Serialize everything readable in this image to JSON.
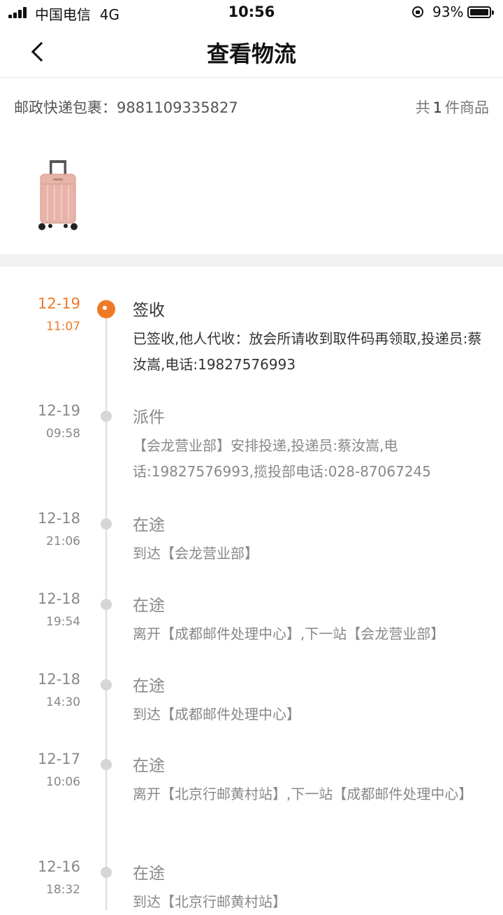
{
  "status_bar": {
    "carrier": "中国电信",
    "network": "4G",
    "time": "10:56",
    "battery": "93%",
    "battery_level": 0.93
  },
  "nav": {
    "title": "查看物流",
    "back_icon": "chevron-left-icon"
  },
  "package": {
    "label": "邮政快递包裹：9881109335827",
    "count_prefix": "共",
    "count": "1",
    "count_suffix": "件商品",
    "thumbnail_icon": "suitcase-icon"
  },
  "accent_color": "#ee7a26",
  "events": [
    {
      "date": "12-19",
      "time": "11:07",
      "status": "签收",
      "desc": "已签收,他人代收：放会所请收到取件码再领取,投递员:蔡汝嵩,电话:19827576993"
    },
    {
      "date": "12-19",
      "time": "09:58",
      "status": "派件",
      "desc": "【会龙营业部】安排投递,投递员:蔡汝嵩,电话:19827576993,揽投部电话:028-87067245"
    },
    {
      "date": "12-18",
      "time": "21:06",
      "status": "在途",
      "desc": "到达【会龙营业部】"
    },
    {
      "date": "12-18",
      "time": "19:54",
      "status": "在途",
      "desc": "离开【成都邮件处理中心】,下一站【会龙营业部】"
    },
    {
      "date": "12-18",
      "time": "14:30",
      "status": "在途",
      "desc": "到达【成都邮件处理中心】"
    },
    {
      "date": "12-17",
      "time": "10:06",
      "status": "在途",
      "desc": "离开【北京行邮黄村站】,下一站【成都邮件处理中心】"
    },
    {
      "date": "12-16",
      "time": "18:32",
      "status": "在途",
      "desc": "到达【北京行邮黄村站】"
    }
  ]
}
